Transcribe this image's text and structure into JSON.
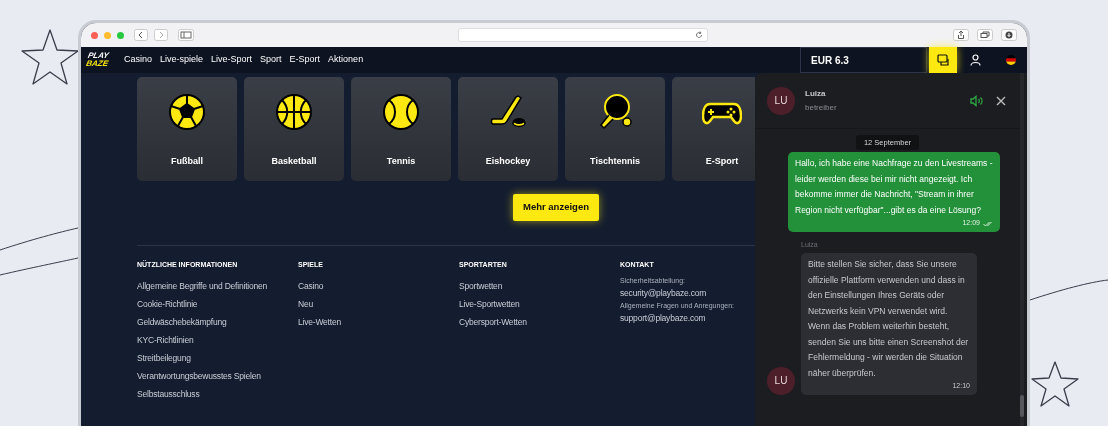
{
  "header": {
    "logo": [
      "PLAY",
      "BAZE"
    ],
    "nav": [
      {
        "label": "Casino"
      },
      {
        "label": "Live-spiele"
      },
      {
        "label": "Live-Sport"
      },
      {
        "label": "Sport"
      },
      {
        "label": "E-Sport"
      },
      {
        "label": "Aktionen"
      }
    ],
    "balance": "EUR 6.3",
    "chat_button": {
      "active": true
    }
  },
  "sports": [
    {
      "kind": "football",
      "label": "Fußball"
    },
    {
      "kind": "basketball",
      "label": "Basketball"
    },
    {
      "kind": "tennis",
      "label": "Tennis"
    },
    {
      "kind": "hockey",
      "label": "Eishockey"
    },
    {
      "kind": "tabletennis",
      "label": "Tischtennis"
    },
    {
      "kind": "gamepad",
      "label": "E-Sport"
    }
  ],
  "more_button": "Mehr anzeigen",
  "footer": [
    {
      "heading": "NÜTZLICHE INFORMATIONEN",
      "items": [
        {
          "kind": "link",
          "text": "Allgemeine Begriffe und Definitionen"
        },
        {
          "kind": "link",
          "text": "Cookie-Richtlinie"
        },
        {
          "kind": "link",
          "text": "Geldwäschebekämpfung"
        },
        {
          "kind": "link",
          "text": "KYC-Richtlinien"
        },
        {
          "kind": "link",
          "text": "Streitbeilegung"
        },
        {
          "kind": "link",
          "text": "Verantwortungsbewusstes Spielen"
        },
        {
          "kind": "link",
          "text": "Selbstausschluss"
        }
      ]
    },
    {
      "heading": "SPIELE",
      "items": [
        {
          "kind": "link",
          "text": "Casino"
        },
        {
          "kind": "link",
          "text": "Neu"
        },
        {
          "kind": "link",
          "text": "Live-Wetten"
        }
      ]
    },
    {
      "heading": "SPORTARTEN",
      "items": [
        {
          "kind": "link",
          "text": "Sportwetten"
        },
        {
          "kind": "link",
          "text": "Live-Sportwetten"
        },
        {
          "kind": "link",
          "text": "Cybersport-Wetten"
        }
      ]
    },
    {
      "heading": "KONTAKT",
      "items": [
        {
          "kind": "caption",
          "text": "Sicherheitsabteilung:"
        },
        {
          "kind": "link",
          "text": "security@playbaze.com"
        },
        {
          "kind": "caption",
          "text": "Allgemeine Fragen und Anregungen:"
        },
        {
          "kind": "link",
          "text": "support@playbaze.com"
        }
      ]
    }
  ],
  "chat": {
    "agent": {
      "initials": "LU",
      "name": "Luiza",
      "role": "betreiber"
    },
    "sound_on": true,
    "date_divider": "12 September",
    "messages": [
      {
        "kind": "outgoing",
        "text": "Hallo, ich habe eine Nachfrage zu den Livestreams - leider werden diese bei mir nicht angezeigt. Ich bekomme immer die Nachricht, \"Stream in ihrer Region nicht verfügbar\"...gibt es da eine Lösung?",
        "time": "12:09",
        "read": true
      },
      {
        "kind": "incoming",
        "sender": "Luiza",
        "initials": "LU",
        "text": "Bitte stellen Sie sicher, dass Sie unsere offizielle Plattform verwenden und dass in den Einstellungen Ihres Geräts oder Netzwerks kein VPN verwendet wird. Wenn das Problem weiterhin besteht, senden Sie uns bitte einen Screenshot der Fehlermeldung - wir werden die Situation näher überprüfen.",
        "time": "12:10"
      }
    ]
  }
}
